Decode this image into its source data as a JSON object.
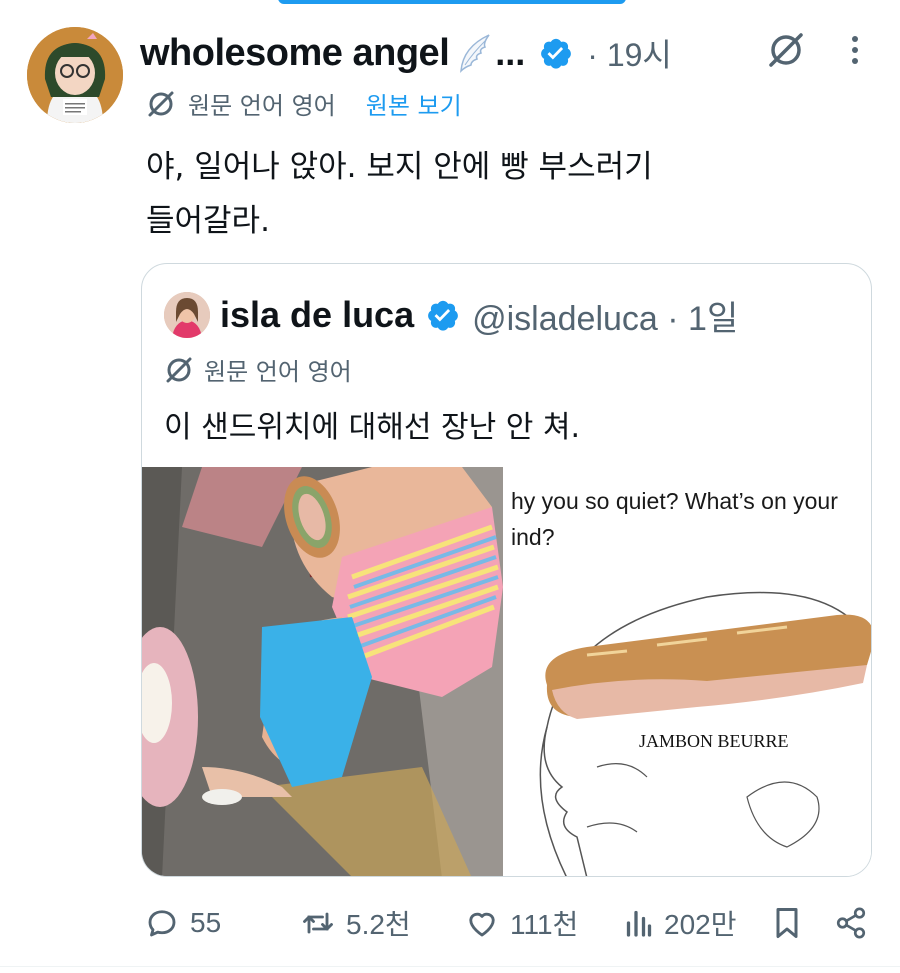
{
  "colors": {
    "accent": "#1d9bf0",
    "text": "#0f1419",
    "muted": "#536471",
    "border": "#cfd9de"
  },
  "tweet": {
    "author_name": "wholesome angel",
    "name_ellipsis": "...",
    "time": "· 19시",
    "translate_label": "원문 언어 영어",
    "show_original": "원본 보기",
    "text_line1": "야, 일어나 앉아. 보지 안에 빵 부스러기",
    "text_line2": "들어갈라."
  },
  "quoted_tweet": {
    "author_name": "isla de luca",
    "handle_time": "@isladeluca · 1일",
    "translate_label": "원문 언어 영어",
    "text": "이 샌드위치에 대해선 장난 안 쳐.",
    "meme": {
      "caption": "hy you so quiet? What’s on your ind?",
      "caption_line1": "hy you so quiet? What’s on your",
      "caption_line2": "ind?",
      "label": "JAMBON BEURRE"
    }
  },
  "actions": {
    "replies": "55",
    "reposts": "5.2천",
    "likes": "111천",
    "views": "202만"
  },
  "icons": [
    "grok-icon",
    "more-icon",
    "translate-icon",
    "verified-badge-icon",
    "reply-icon",
    "repost-icon",
    "like-icon",
    "views-icon",
    "bookmark-icon",
    "share-icon"
  ]
}
